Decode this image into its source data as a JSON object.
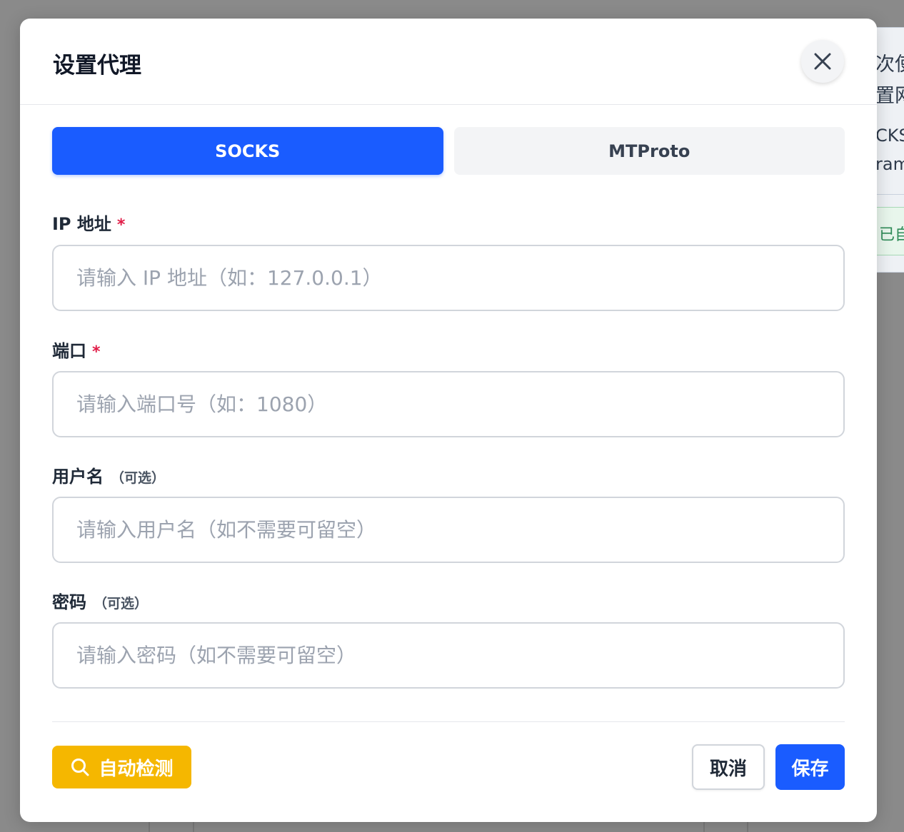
{
  "background": {
    "text_lines": [
      "次使",
      "置网",
      "CKS",
      "ram"
    ],
    "badge": "已自"
  },
  "dialog": {
    "title": "设置代理",
    "close_icon": "close-icon"
  },
  "tabs": [
    {
      "label": "SOCKS",
      "active": true
    },
    {
      "label": "MTProto",
      "active": false
    }
  ],
  "fields": {
    "ip": {
      "label": "IP 地址",
      "required_mark": "*",
      "placeholder": "请输入 IP 地址（如：127.0.0.1）",
      "value": ""
    },
    "port": {
      "label": "端口",
      "required_mark": "*",
      "placeholder": "请输入端口号（如：1080）",
      "value": ""
    },
    "username": {
      "label": "用户名",
      "optional_note": "（可选）",
      "placeholder": "请输入用户名（如不需要可留空）",
      "value": ""
    },
    "password": {
      "label": "密码",
      "optional_note": "（可选）",
      "placeholder": "请输入密码（如不需要可留空）",
      "value": ""
    }
  },
  "footer": {
    "detect_label": "自动检测",
    "detect_icon": "search-icon",
    "cancel_label": "取消",
    "save_label": "保存"
  },
  "colors": {
    "primary": "#1a5cff",
    "warning": "#f5b700",
    "required": "#e11d48"
  }
}
